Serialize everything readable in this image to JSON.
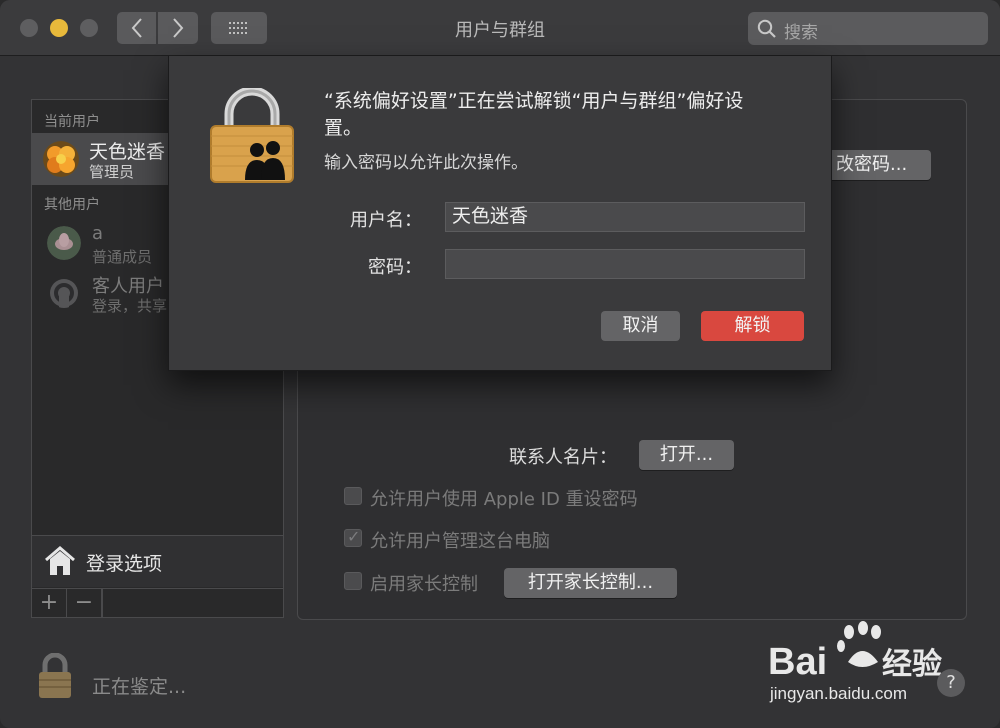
{
  "window": {
    "title": "用户与群组"
  },
  "search": {
    "placeholder": "搜索"
  },
  "sidebar": {
    "current_section": "当前用户",
    "current_user": {
      "name": "天色迷香",
      "role": "管理员"
    },
    "other_section": "其他用户",
    "others": [
      {
        "name": "a",
        "role": "普通成员"
      },
      {
        "name": "客人用户",
        "role": "登录，共享"
      }
    ],
    "login_options": "登录选项",
    "add": "+",
    "remove": "−"
  },
  "main": {
    "change_password": "改密码...",
    "contacts_label": "联系人名片：",
    "contacts_open": "打开...",
    "checkboxes": [
      {
        "label": "允许用户使用 Apple ID 重设密码",
        "checked": false
      },
      {
        "label": "允许用户管理这台电脑",
        "checked": true
      },
      {
        "label": "启用家长控制",
        "checked": false
      }
    ],
    "parental_button": "打开家长控制..."
  },
  "bottom": {
    "status": "正在鉴定..."
  },
  "dialog": {
    "title": "“系统偏好设置”正在尝试解锁“用户与群组”偏好设置。",
    "subtitle": "输入密码以允许此次操作。",
    "username_label": "用户名：",
    "username_value": "天色迷香",
    "password_label": "密码：",
    "password_value": "",
    "cancel": "取消",
    "unlock": "解锁"
  },
  "watermark": {
    "logo": "Bai du 经验",
    "url": "jingyan.baidu.com"
  },
  "help": "?",
  "colors": {
    "accent_unlock": "#d9483f",
    "traffic_minimize": "#e8b93b"
  }
}
